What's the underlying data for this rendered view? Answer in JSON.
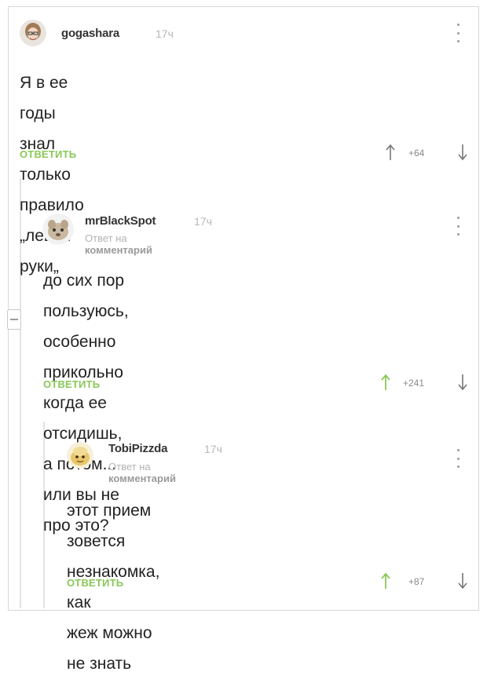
{
  "comments": [
    {
      "username": "gogashara",
      "time": "17ч",
      "reply_prefix": "",
      "reply_link": "",
      "text_lines": [
        "Я в ее годы знал только правило „левой",
        "руки„"
      ],
      "reply_label": "ОТВЕТИТЬ",
      "rating": "+64",
      "up_active": false
    },
    {
      "username": "mrBlackSpot",
      "time": "17ч",
      "reply_prefix": "Ответ на",
      "reply_link": "комментарий",
      "text_lines": [
        "до сих пор пользуюсь, особенно",
        "прикольно когда ее отсидишь, а потом...",
        "или вы не про это?"
      ],
      "reply_label": "ОТВЕТИТЬ",
      "rating": "+241",
      "up_active": true
    },
    {
      "username": "TobiPizzda",
      "time": "17ч",
      "reply_prefix": "Ответ на",
      "reply_link": "комментарий",
      "text_lines": [
        "этот прием зовется незнакомка, как",
        "жеж можно не знать"
      ],
      "reply_label": "ОТВЕТИТЬ",
      "rating": "+87",
      "up_active": true
    }
  ],
  "colors": {
    "accent_green": "#8ac858",
    "muted_gray": "#b3b3b3"
  },
  "icons": {
    "upvote": "arrow-up-icon",
    "downvote": "arrow-down-icon",
    "menu": "more-vertical-icon",
    "collapse": "collapse-thread-icon"
  }
}
